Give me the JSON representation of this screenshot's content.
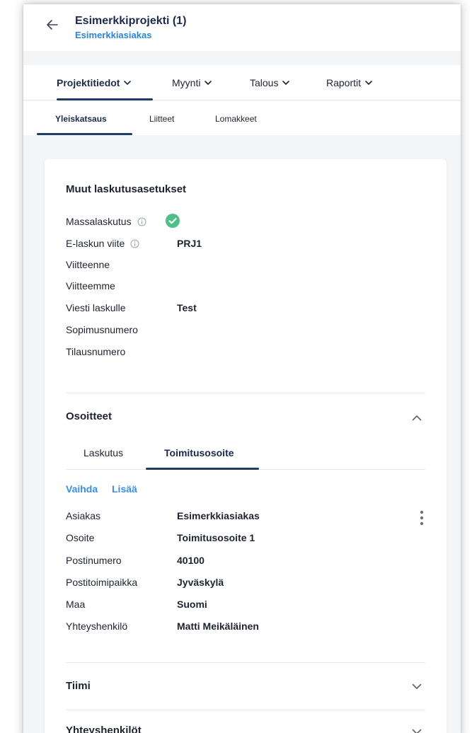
{
  "header": {
    "title": "Esimerkkiprojekti (1)",
    "subtitle": "Esimerkkiasiakas",
    "back_icon": "arrow-left-icon"
  },
  "nav": {
    "items": [
      {
        "label": "Projektitiedot"
      },
      {
        "label": "Myynti"
      },
      {
        "label": "Talous"
      },
      {
        "label": "Raportit"
      }
    ]
  },
  "subnav": {
    "items": [
      {
        "label": "Yleiskatsaus"
      },
      {
        "label": "Liitteet"
      },
      {
        "label": "Lomakkeet"
      }
    ]
  },
  "billing": {
    "title": "Muut laskutusasetukset",
    "rows": [
      {
        "label": "Massalaskutus",
        "value": ""
      },
      {
        "label": "E-laskun viite",
        "value": "PRJ1"
      },
      {
        "label": "Viitteenne",
        "value": ""
      },
      {
        "label": "Viitteemme",
        "value": ""
      },
      {
        "label": "Viesti laskulle",
        "value": "Test"
      },
      {
        "label": "Sopimusnumero",
        "value": ""
      },
      {
        "label": "Tilausnumero",
        "value": ""
      }
    ],
    "massalaskutus_enabled": true
  },
  "addresses": {
    "title": "Osoitteet",
    "tabs": [
      {
        "label": "Laskutus"
      },
      {
        "label": "Toimitusosoite"
      }
    ],
    "actions": {
      "change": "Vaihda",
      "add": "Lisää"
    },
    "rows": [
      {
        "label": "Asiakas",
        "value": "Esimerkkiasiakas"
      },
      {
        "label": "Osoite",
        "value": "Toimitusosoite 1"
      },
      {
        "label": "Postinumero",
        "value": "40100"
      },
      {
        "label": "Postitoimipaikka",
        "value": "Jyväskylä"
      },
      {
        "label": "Maa",
        "value": "Suomi"
      },
      {
        "label": "Yhteyshenkilö",
        "value": "Matti Meikäläinen"
      }
    ]
  },
  "team": {
    "title": "Tiimi"
  },
  "contacts": {
    "title": "Yhteyshenkilöt"
  },
  "colors": {
    "accent": "#2a84d6",
    "link": "#3a8ee6",
    "navy": "#1b2a4a",
    "success": "#4cbf8a"
  }
}
